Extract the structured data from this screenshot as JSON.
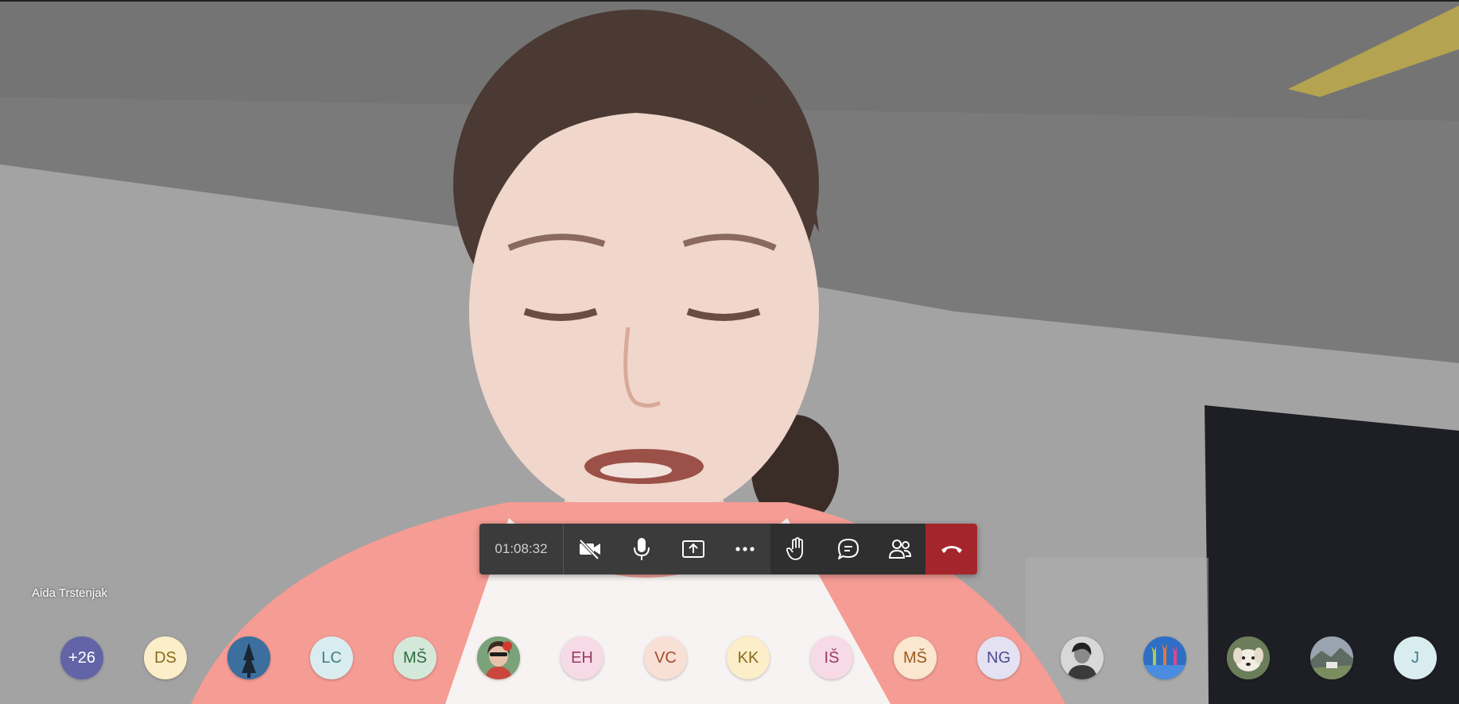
{
  "participant": {
    "name": "Aida Trstenjak"
  },
  "toolbar": {
    "timer": "01:08:32",
    "buttons": [
      {
        "name": "camera-off-button",
        "icon": "camera-off-icon"
      },
      {
        "name": "microphone-button",
        "icon": "microphone-icon"
      },
      {
        "name": "share-screen-button",
        "icon": "share-screen-icon"
      },
      {
        "name": "more-actions-button",
        "icon": "more-horizontal-icon"
      },
      {
        "name": "raise-hand-button",
        "icon": "hand-icon"
      },
      {
        "name": "chat-button",
        "icon": "chat-icon"
      },
      {
        "name": "participants-button",
        "icon": "people-icon"
      },
      {
        "name": "hang-up-button",
        "icon": "phone-hangup-icon"
      }
    ],
    "colors": {
      "bar": "#3b3b3b",
      "bar_secondary": "#2f2f2f",
      "hangup": "#a4262c",
      "icon": "#ffffff"
    }
  },
  "avatars": [
    {
      "label": "+26",
      "bg": "#6264a7",
      "fg": "#ffffff",
      "type": "overflow"
    },
    {
      "label": "DS",
      "bg": "#fbeec8",
      "fg": "#8a6a1b",
      "type": "initials"
    },
    {
      "label": "",
      "bg": "#3c6f9e",
      "fg": "#ffffff",
      "type": "photo",
      "photo": "tree-silhouette"
    },
    {
      "label": "LC",
      "bg": "#d9edf0",
      "fg": "#3f7c86",
      "type": "initials"
    },
    {
      "label": "MŠ",
      "bg": "#d4e8d9",
      "fg": "#2f6b3f",
      "type": "initials"
    },
    {
      "label": "",
      "bg": "#c77b6d",
      "fg": "#ffffff",
      "type": "photo",
      "photo": "woman-red-flower"
    },
    {
      "label": "EH",
      "bg": "#f6dbe6",
      "fg": "#9b3a63",
      "type": "initials"
    },
    {
      "label": "VC",
      "bg": "#f9e0d6",
      "fg": "#a24b2d",
      "type": "initials"
    },
    {
      "label": "KK",
      "bg": "#fbeec8",
      "fg": "#8a6a1b",
      "type": "initials"
    },
    {
      "label": "IŠ",
      "bg": "#f6dbe6",
      "fg": "#9b3a63",
      "type": "initials"
    },
    {
      "label": "MŠ",
      "bg": "#fbe6cf",
      "fg": "#9a5a1e",
      "type": "initials"
    },
    {
      "label": "NG",
      "bg": "#e3e1f2",
      "fg": "#4f4b8c",
      "type": "initials"
    },
    {
      "label": "",
      "bg": "#777777",
      "fg": "#ffffff",
      "type": "photo",
      "photo": "person-grayscale"
    },
    {
      "label": "",
      "bg": "#2e6fc6",
      "fg": "#ffffff",
      "type": "photo",
      "photo": "easter-bunnies"
    },
    {
      "label": "",
      "bg": "#6b7d5a",
      "fg": "#ffffff",
      "type": "photo",
      "photo": "white-dog"
    },
    {
      "label": "",
      "bg": "#8b8f95",
      "fg": "#ffffff",
      "type": "photo",
      "photo": "landscape"
    },
    {
      "label": "J",
      "bg": "#d9edf0",
      "fg": "#3f7c86",
      "type": "initials"
    }
  ]
}
